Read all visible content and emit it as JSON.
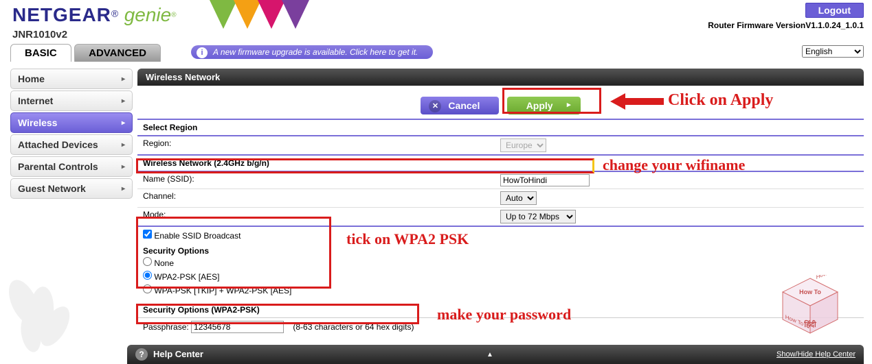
{
  "header": {
    "brand": "NETGEAR",
    "sub_brand": "genie",
    "model": "JNR1010v2",
    "logout": "Logout",
    "firmware": "Router Firmware VersionV1.1.0.24_1.0.1"
  },
  "tabs": {
    "basic": "BASIC",
    "advanced": "ADVANCED"
  },
  "firmware_banner": "A new firmware upgrade is available. Click here to get it.",
  "language": {
    "selected": "English"
  },
  "sidebar": {
    "items": [
      {
        "label": "Home"
      },
      {
        "label": "Internet"
      },
      {
        "label": "Wireless"
      },
      {
        "label": "Attached Devices"
      },
      {
        "label": "Parental Controls"
      },
      {
        "label": "Guest Network"
      }
    ]
  },
  "content": {
    "title": "Wireless Network",
    "buttons": {
      "cancel": "Cancel",
      "apply": "Apply"
    },
    "region_section": "Select Region",
    "region_label": "Region:",
    "region_value": "Europe",
    "network_section": "Wireless Network (2.4GHz b/g/n)",
    "ssid_label": "Name (SSID):",
    "ssid_value": "HowToHindi",
    "channel_label": "Channel:",
    "channel_value": "Auto",
    "mode_label": "Mode:",
    "mode_value": "Up to 72 Mbps",
    "enable_ssid": "Enable SSID Broadcast",
    "security_section": "Security Options",
    "sec_none": "None",
    "sec_wpa2": "WPA2-PSK [AES]",
    "sec_wpa_mix": "WPA-PSK [TKIP] + WPA2-PSK [AES]",
    "pass_section": "Security Options (WPA2-PSK)",
    "pass_label": "Passphrase:",
    "pass_value": "12345678",
    "pass_hint": "(8-63 characters or 64 hex digits)"
  },
  "help": {
    "title": "Help Center",
    "toggle": "Show/Hide Help Center"
  },
  "annotations": {
    "apply": "Click on Apply",
    "wifiname": "change your wifiname",
    "wpa2": "tick on WPA2 PSK",
    "password": "make your password"
  }
}
